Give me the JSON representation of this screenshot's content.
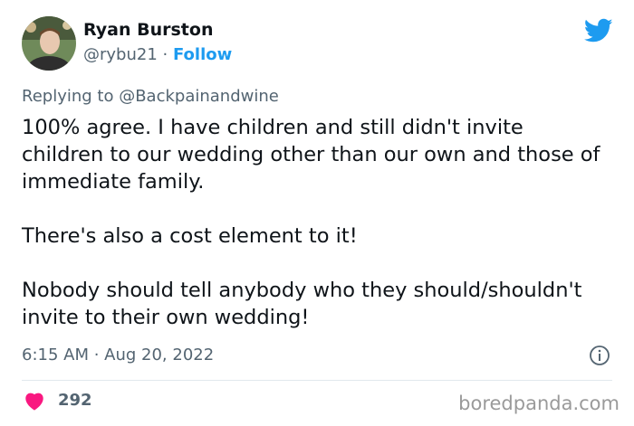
{
  "author": {
    "name": "Ryan Burston",
    "handle": "@rybu21",
    "separator": " · ",
    "follow_label": "Follow"
  },
  "reply": {
    "prefix": "Replying to ",
    "mention": "@Backpainandwine"
  },
  "tweet": {
    "paragraph_1": "100% agree. I have children and still didn't invite children to our wedding other than our own and those of immediate family.",
    "paragraph_2": "There's also a cost element to it!",
    "paragraph_3": "Nobody should tell anybody who they should/shouldn't invite to their own wedding!"
  },
  "meta": {
    "timestamp": "6:15 AM · Aug 20, 2022"
  },
  "engagement": {
    "likes": "292"
  },
  "watermark": "boredpanda.com",
  "colors": {
    "twitter_blue": "#1d9bf0",
    "heart": "#f91880",
    "secondary_text": "#536471"
  },
  "icons": {
    "brand": "twitter-bird-icon",
    "info": "info-icon",
    "like": "heart-icon"
  }
}
